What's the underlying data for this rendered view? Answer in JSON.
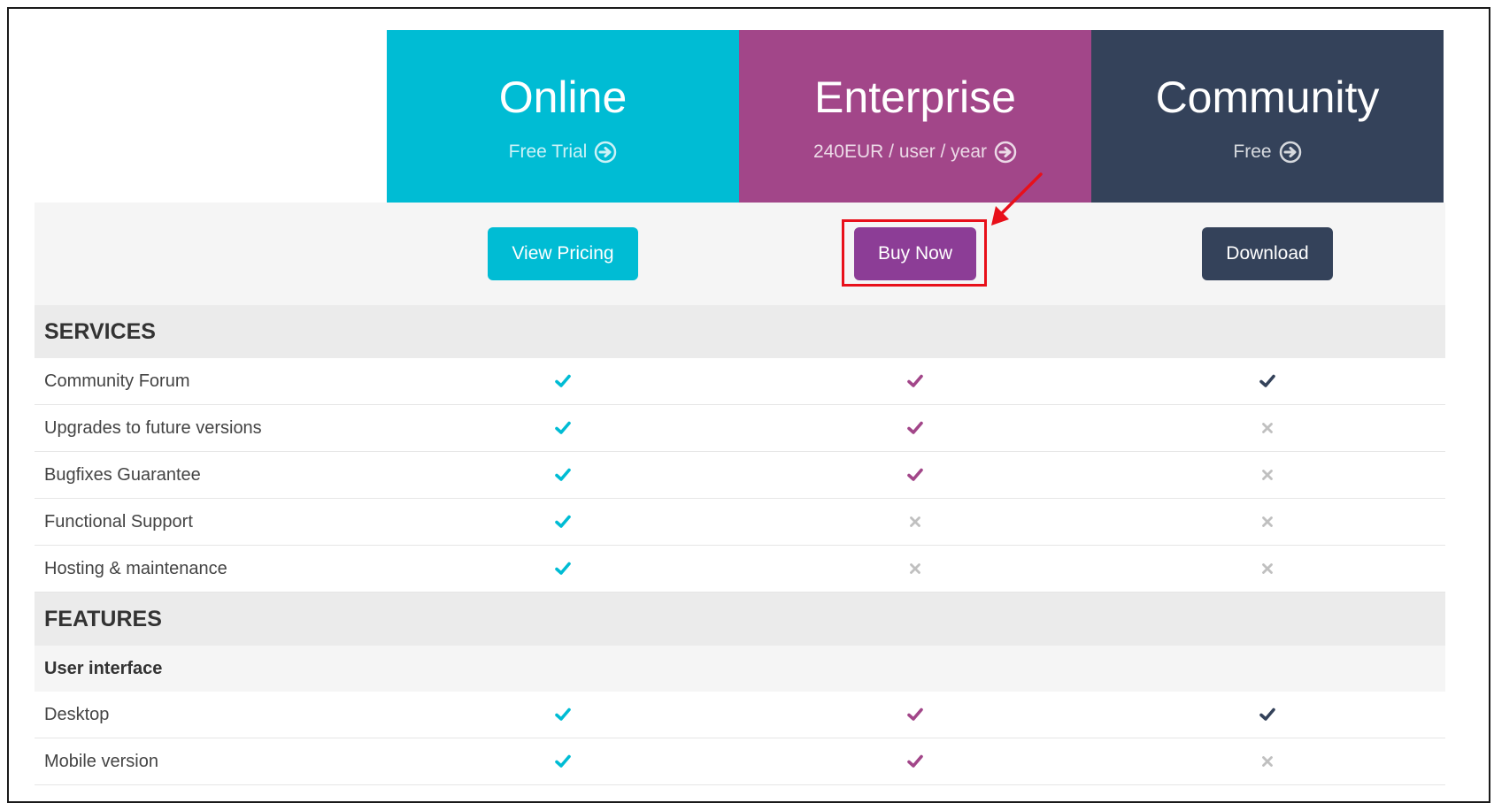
{
  "colors": {
    "online": "#00bcd4",
    "enterprise": "#a24689",
    "community": "#34425a",
    "cross": "#c0c0c0",
    "annotation": "#e8101a",
    "buy_button": "#8c3d96"
  },
  "plans": [
    {
      "title": "Online",
      "subtitle": "Free Trial",
      "button": "View Pricing",
      "icon": "circle-arrow-right-icon"
    },
    {
      "title": "Enterprise",
      "subtitle": "240EUR / user / year",
      "button": "Buy Now",
      "icon": "circle-arrow-right-icon"
    },
    {
      "title": "Community",
      "subtitle": "Free",
      "button": "Download",
      "icon": "circle-arrow-right-icon"
    }
  ],
  "sections": {
    "services": {
      "title": "SERVICES",
      "rows": [
        {
          "label": "Community Forum",
          "values": [
            true,
            true,
            true
          ]
        },
        {
          "label": "Upgrades to future versions",
          "values": [
            true,
            true,
            false
          ]
        },
        {
          "label": "Bugfixes Guarantee",
          "values": [
            true,
            true,
            false
          ]
        },
        {
          "label": "Functional Support",
          "values": [
            true,
            false,
            false
          ]
        },
        {
          "label": "Hosting & maintenance",
          "values": [
            true,
            false,
            false
          ]
        }
      ]
    },
    "features": {
      "title": "FEATURES",
      "group": "User interface",
      "rows": [
        {
          "label": "Desktop",
          "values": [
            true,
            true,
            true
          ]
        },
        {
          "label": "Mobile version",
          "values": [
            true,
            true,
            false
          ]
        }
      ]
    }
  }
}
